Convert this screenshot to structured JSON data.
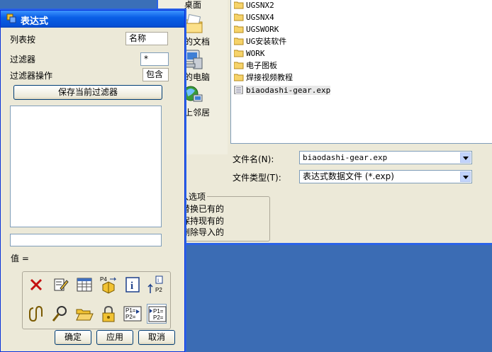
{
  "expressions_dialog": {
    "title": "表达式",
    "list_by_label": "列表按",
    "list_by_value": "名称",
    "filter_label": "过滤器",
    "filter_value": "*",
    "filter_op_label": "过滤器操作",
    "filter_op_value": "包含",
    "save_filter_button": "保存当前过滤器",
    "value_label": "值 =",
    "ok_button": "确定",
    "apply_button": "应用",
    "cancel_button": "取消",
    "toolbar": [
      {
        "icon": "delete-icon"
      },
      {
        "icon": "edit-icon"
      },
      {
        "icon": "spreadsheet-icon"
      },
      {
        "icon": "import-icon"
      },
      {
        "icon": "info-icon"
      },
      {
        "icon": "export-parameters-icon"
      },
      {
        "icon": "link-icon"
      },
      {
        "icon": "find-icon"
      },
      {
        "icon": "open-folder-icon"
      },
      {
        "icon": "lock-icon"
      },
      {
        "icon": "parameter-list-icon"
      },
      {
        "icon": "parameter-rename-icon"
      }
    ]
  },
  "import_dialog": {
    "places": [
      {
        "label": "桌面",
        "icon": "desktop-icon"
      },
      {
        "label": "我的文档",
        "icon": "my-documents-icon"
      },
      {
        "label": "我的电脑",
        "icon": "my-computer-icon"
      },
      {
        "label": "网上邻居",
        "icon": "network-icon"
      }
    ],
    "files": [
      {
        "name": "UGSNX2",
        "type": "folder"
      },
      {
        "name": "UGSNX4",
        "type": "folder"
      },
      {
        "name": "UGSWORK",
        "type": "folder"
      },
      {
        "name": "UG安装软件",
        "type": "folder"
      },
      {
        "name": "WORK",
        "type": "folder"
      },
      {
        "name": "电子图板",
        "type": "folder"
      },
      {
        "name": "焊接视频教程",
        "type": "folder"
      },
      {
        "name": "biaodashi-gear.exp",
        "type": "file"
      }
    ],
    "filename_label": "文件名(N):",
    "filename_value": "biaodashi-gear.exp",
    "filetype_label": "文件类型(T):",
    "filetype_value": "表达式数据文件 (*.exp)",
    "import_options_title": "导入选项",
    "options": [
      {
        "label": "替换已有的",
        "checked": true
      },
      {
        "label": "保持现有的",
        "checked": false
      },
      {
        "label": "删除导入的",
        "checked": false
      }
    ]
  }
}
